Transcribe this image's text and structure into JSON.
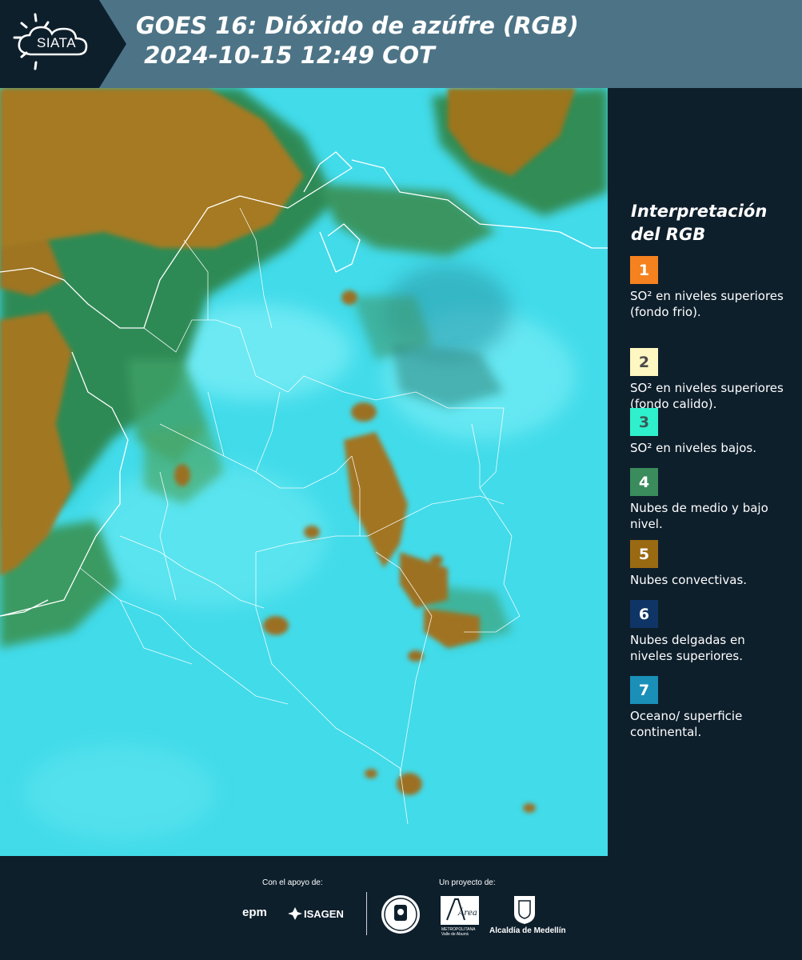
{
  "header": {
    "logo_text": "SIATA",
    "title_line1": "GOES 16: Dióxido de azúfre (RGB)",
    "title_line2": " 2024-10-15 12:49 COT",
    "colors": {
      "band": "#4d7486",
      "logo_bg": "#0e1f2c"
    }
  },
  "map": {
    "description_icon": "satellite-map",
    "colors": {
      "base": "#40dcec",
      "convective": "#a3771f",
      "mid_low": "#2f8a4e"
    }
  },
  "legend": {
    "title": "Interpretación del RGB",
    "items": [
      {
        "number": "1",
        "label": "SO² en niveles superiores (fondo frio).",
        "color": "#f5821f",
        "text_color": "#ffffff"
      },
      {
        "number": "2",
        "label": "SO² en niveles superiores (fondo calido).",
        "color": "#fff7c2",
        "text_color": "#4a4a4a"
      },
      {
        "number": "3",
        "label": "SO² en niveles bajos.",
        "color": "#2ff0cc",
        "text_color": "#3a5a55"
      },
      {
        "number": "4",
        "label": "Nubes de medio y bajo nivel.",
        "color": "#3a8c5c",
        "text_color": "#ffffff"
      },
      {
        "number": "5",
        "label": "Nubes convectivas.",
        "color": "#9a6a12",
        "text_color": "#ffffff"
      },
      {
        "number": "6",
        "label": "Nubes delgadas en niveles superiores.",
        "color": "#0f3566",
        "text_color": "#ffffff"
      },
      {
        "number": "7",
        "label": "Oceano/ superficie continental.",
        "color": "#1a8fb8",
        "text_color": "#ffffff"
      }
    ]
  },
  "footer": {
    "support_label": "Con el apoyo de:",
    "project_label": "Un proyecto de:",
    "sponsors": [
      "epm",
      "ISAGEN"
    ],
    "amva_name": "Área",
    "amva_sub": "METROPOLITANA Valle de Aburrá",
    "alcaldia": "Alcaldía de Medellín"
  }
}
